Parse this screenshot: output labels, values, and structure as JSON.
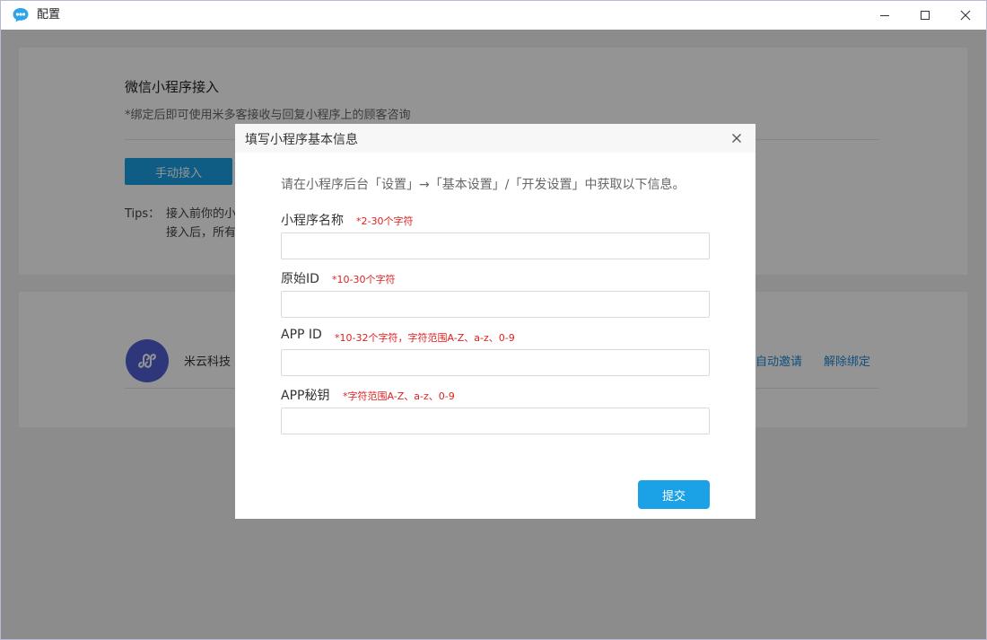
{
  "window": {
    "title": "配置"
  },
  "config_panel": {
    "title": "微信小程序接入",
    "description": "*绑定后即可使用米多客接收与回复小程序上的顾客咨询",
    "manual_button": "手动接入",
    "tips_label": "Tips：",
    "tips_line1": "接入前你的小",
    "tips_line2": "接入后，所有"
  },
  "bound_app": {
    "name": "米云科技",
    "invite_link": "自动邀请",
    "unbind_link": "解除绑定"
  },
  "modal": {
    "title": "填写小程序基本信息",
    "instruction": "请在小程序后台「设置」→「基本设置」/「开发设置」中获取以下信息。",
    "fields": [
      {
        "label": "小程序名称",
        "hint": "*2-30个字符",
        "value": ""
      },
      {
        "label": "原始ID",
        "hint": "*10-30个字符",
        "value": ""
      },
      {
        "label": "APP ID",
        "hint": "*10-32个字符，字符范围A-Z、a-z、0-9",
        "value": ""
      },
      {
        "label": "APP秘钥",
        "hint": "*字符范围A-Z、a-z、0-9",
        "value": ""
      }
    ],
    "submit_label": "提交"
  },
  "colors": {
    "primary": "#1aa1e6",
    "link": "#1e88d6",
    "hint": "#e02020",
    "avatar": "#4e5fd3"
  }
}
